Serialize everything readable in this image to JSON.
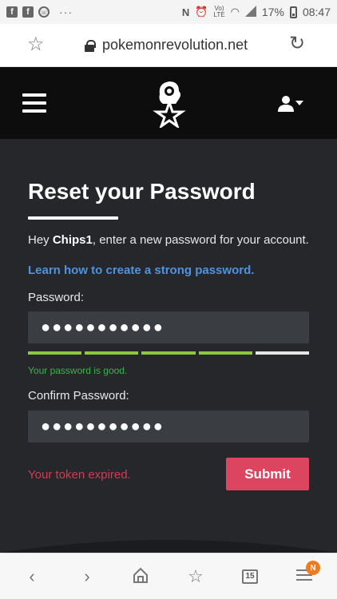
{
  "status": {
    "battery": "17%",
    "time": "08:47",
    "volte_top": "Vo)",
    "volte_bottom": "LTE"
  },
  "browser": {
    "url": "pokemonrevolution.net",
    "tabs_count": "15",
    "menu_badge": "N"
  },
  "form": {
    "title": "Reset your Password",
    "greeting_prefix": "Hey ",
    "username": "Chips1",
    "greeting_suffix": ", enter a new password for your account.",
    "learn_link": "Learn how to create a strong password.",
    "password_label": "Password:",
    "password_value": "●●●●●●●●●●●",
    "strength_message": "Your password is good.",
    "strength_level": 0.8,
    "confirm_label": "Confirm Password:",
    "confirm_value": "●●●●●●●●●●●",
    "error": "Your token expired.",
    "submit": "Submit"
  },
  "colors": {
    "link": "#4f93e0",
    "accent": "#db4560",
    "good": "#3fb24e",
    "strength": "#8dc63f"
  }
}
